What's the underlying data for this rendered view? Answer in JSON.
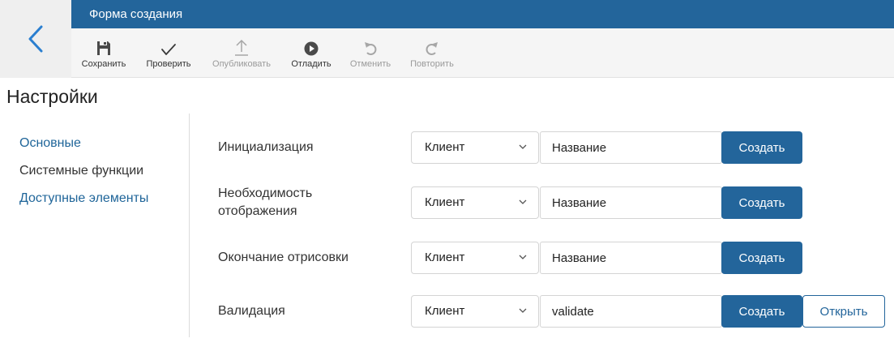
{
  "window": {
    "title": "Форма создания"
  },
  "toolbar": {
    "items": [
      {
        "label": "Сохранить",
        "icon": "save-icon",
        "enabled": true
      },
      {
        "label": "Проверить",
        "icon": "check-icon",
        "enabled": true
      },
      {
        "label": "Опубликовать",
        "icon": "publish-icon",
        "enabled": false
      },
      {
        "label": "Отладить",
        "icon": "debug-play-icon",
        "enabled": true
      },
      {
        "label": "Отменить",
        "icon": "undo-icon",
        "enabled": false
      },
      {
        "label": "Повторить",
        "icon": "redo-icon",
        "enabled": false
      }
    ]
  },
  "page": {
    "title": "Настройки"
  },
  "sidebar": {
    "items": [
      {
        "label": "Основные",
        "active": false
      },
      {
        "label": "Системные функции",
        "active": true
      },
      {
        "label": "Доступные элементы",
        "active": false
      }
    ]
  },
  "functions": {
    "rows": [
      {
        "label": "Инициализация",
        "select_value": "Клиент",
        "input_value": "Название",
        "create_label": "Создать"
      },
      {
        "label": "Необходимость отображения",
        "select_value": "Клиент",
        "input_value": "Название",
        "create_label": "Создать"
      },
      {
        "label": "Окончание отрисовки",
        "select_value": "Клиент",
        "input_value": "Название",
        "create_label": "Создать"
      },
      {
        "label": "Валидация",
        "select_value": "Клиент",
        "input_value": "validate",
        "create_label": "Создать",
        "open_label": "Открыть"
      }
    ]
  },
  "colors": {
    "primary": "#23659b",
    "link": "#1f6599",
    "back_arrow": "#2b7fd0",
    "toolbar_bg": "#f5f5f5",
    "disabled_text": "#9a9a9a"
  }
}
